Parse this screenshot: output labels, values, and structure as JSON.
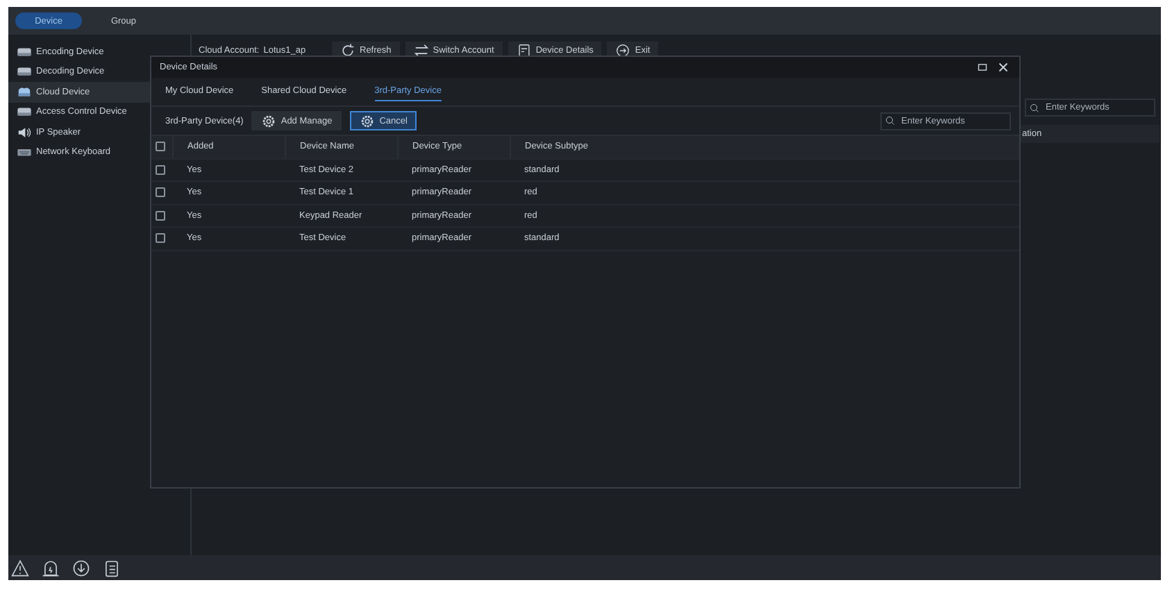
{
  "top_tabs": [
    {
      "label": "Device",
      "selected": true
    },
    {
      "label": "Group",
      "selected": false
    }
  ],
  "sidebar": {
    "items": [
      {
        "label": "Encoding Device",
        "selected": false
      },
      {
        "label": "Decoding Device",
        "selected": false
      },
      {
        "label": "Cloud Device",
        "selected": true
      },
      {
        "label": "Access Control Device",
        "selected": false
      },
      {
        "label": "IP Speaker",
        "selected": false
      },
      {
        "label": "Network Keyboard",
        "selected": false
      }
    ]
  },
  "toolbar": {
    "account_label": "Cloud Account:",
    "account": "Lotus1_ap",
    "buttons": [
      "Refresh",
      "Switch Account",
      "Device Details",
      "Exit"
    ]
  },
  "background": {
    "search": {
      "placeholder": "Enter Keywords"
    },
    "column_header": "ation"
  },
  "dialog": {
    "title": "Device Details",
    "tabs": [
      {
        "label": "My Cloud Device",
        "selected": false
      },
      {
        "label": "Shared Cloud Device",
        "selected": false
      },
      {
        "label": "3rd-Party Device",
        "selected": true
      }
    ],
    "count_label": "3rd-Party Device(4)",
    "buttons": [
      {
        "label": "Add Manage",
        "active": false
      },
      {
        "label": "Cancel",
        "active": true
      }
    ],
    "search": {
      "placeholder": "Enter Keywords"
    },
    "table": {
      "header_checked": false,
      "columns": [
        "Added",
        "Device Name",
        "Device Type",
        "Device Subtype"
      ],
      "rows": [
        {
          "checked": false,
          "cells": [
            "Yes",
            "Test Device 2",
            "primaryReader",
            "standard"
          ]
        },
        {
          "checked": false,
          "cells": [
            "Yes",
            "Test Device 1",
            "primaryReader",
            "red"
          ]
        },
        {
          "checked": false,
          "cells": [
            "Yes",
            "Keypad Reader",
            "primaryReader",
            "red"
          ]
        },
        {
          "checked": false,
          "cells": [
            "Yes",
            "Test Device",
            "primaryReader",
            "standard"
          ]
        }
      ]
    }
  }
}
